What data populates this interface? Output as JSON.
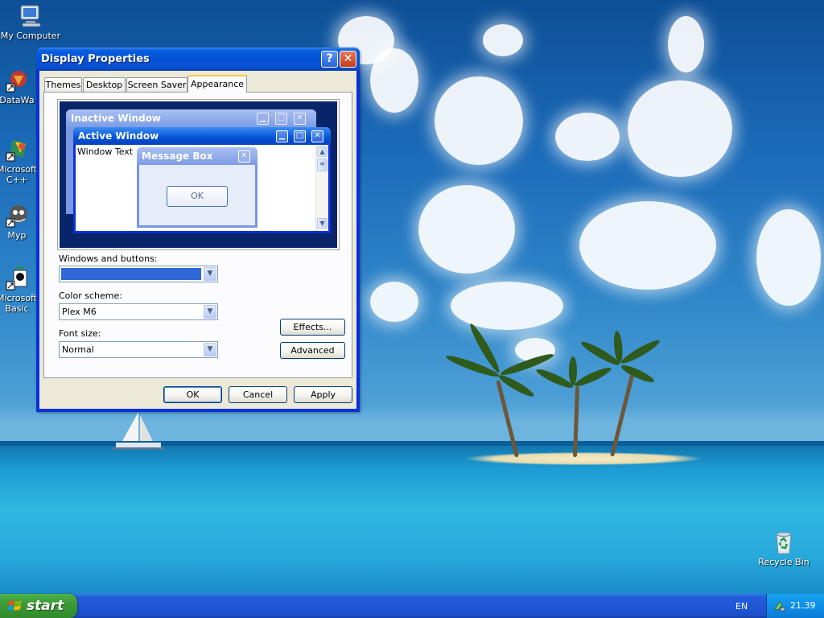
{
  "desktop": {
    "icons": [
      {
        "label": "My Computer"
      },
      {
        "label": "DataWa"
      },
      {
        "label": "Microsoft C++"
      },
      {
        "label": "Myp"
      },
      {
        "label": "Microsoft Basic"
      },
      {
        "label": "Recycle Bin"
      }
    ]
  },
  "window": {
    "title": "Display Properties",
    "help_glyph": "?",
    "close_glyph": "✕",
    "tabs": [
      {
        "label": "Themes"
      },
      {
        "label": "Desktop"
      },
      {
        "label": "Screen Saver"
      },
      {
        "label": "Appearance",
        "active": true
      }
    ],
    "preview": {
      "inactive_title": "Inactive Window",
      "active_title": "Active Window",
      "window_text": "Window Text",
      "message_box_title": "Message Box",
      "message_box_ok": "OK",
      "minimize_glyph": "▁",
      "maximize_glyph": "□",
      "close_glyph": "✕"
    },
    "form": {
      "windows_buttons_label": "Windows and buttons:",
      "windows_buttons_value": "",
      "color_scheme_label": "Color scheme:",
      "color_scheme_value": "Plex M6",
      "font_size_label": "Font size:",
      "font_size_value": "Normal",
      "effects_label": "Effects...",
      "advanced_label": "Advanced"
    },
    "buttons": {
      "ok": "OK",
      "cancel": "Cancel",
      "apply": "Apply"
    }
  },
  "taskbar": {
    "start_label": "start",
    "language": "EN",
    "clock": "21.39"
  },
  "colors": {
    "title_blue": "#0352d6",
    "start_green": "#3c9a35",
    "taskbar_blue": "#1f57d6",
    "dialog_bg": "#ece9d8"
  }
}
